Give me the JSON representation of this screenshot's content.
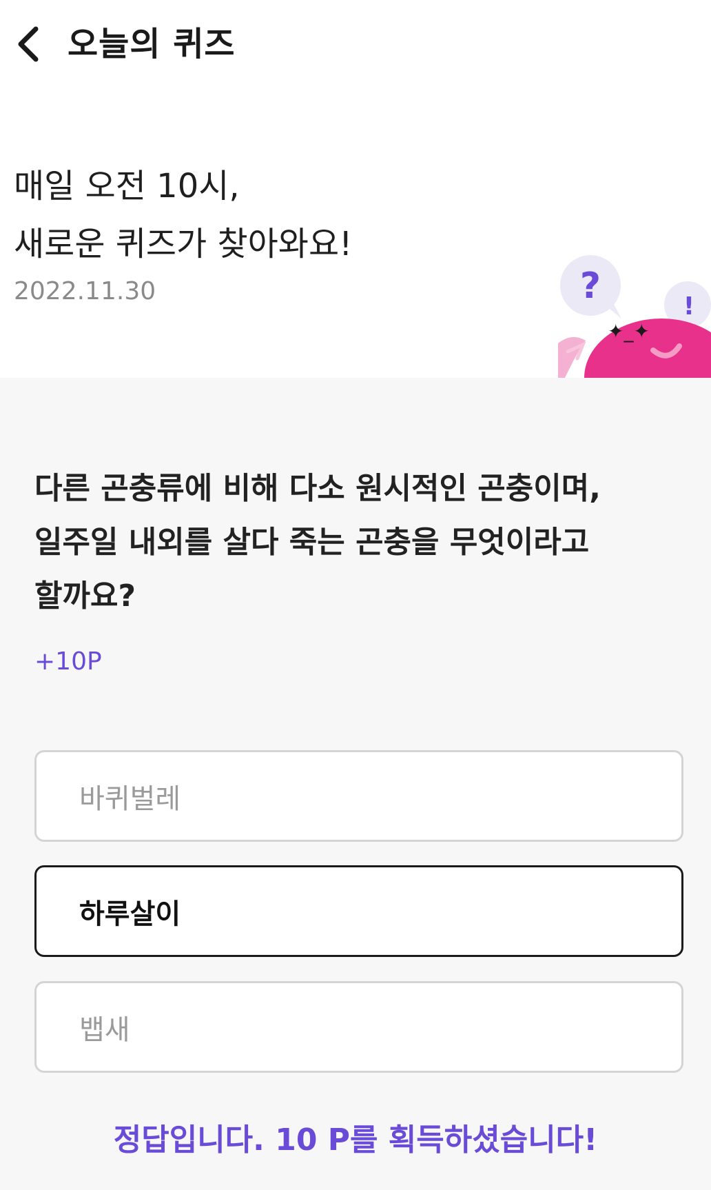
{
  "header": {
    "back_icon": "chevron-left-icon",
    "title": "오늘의 퀴즈"
  },
  "intro": {
    "line1": "매일 오전 10시,",
    "line2": "새로운 퀴즈가 찾아와요!",
    "date": "2022.11.30"
  },
  "mascot": {
    "bubble_question": "?",
    "bubble_exclaim": "!"
  },
  "quiz": {
    "question_line1": "다른 곤충류에 비해 다소 원시적인 곤충이며,",
    "question_line2": "일주일 내외를 살다 죽는 곤충을 무엇이라고",
    "question_line3": "할까요?",
    "points": "+10P",
    "options": [
      {
        "label": "바퀴벌레",
        "selected": false
      },
      {
        "label": "하루살이",
        "selected": true
      },
      {
        "label": "뱁새",
        "selected": false
      }
    ],
    "result_message": "정답입니다. 10 P를 획득하셨습니다!"
  },
  "colors": {
    "accent": "#6a4bd8",
    "mascot_pink": "#e8318a",
    "bubble": "#ece9f7"
  }
}
